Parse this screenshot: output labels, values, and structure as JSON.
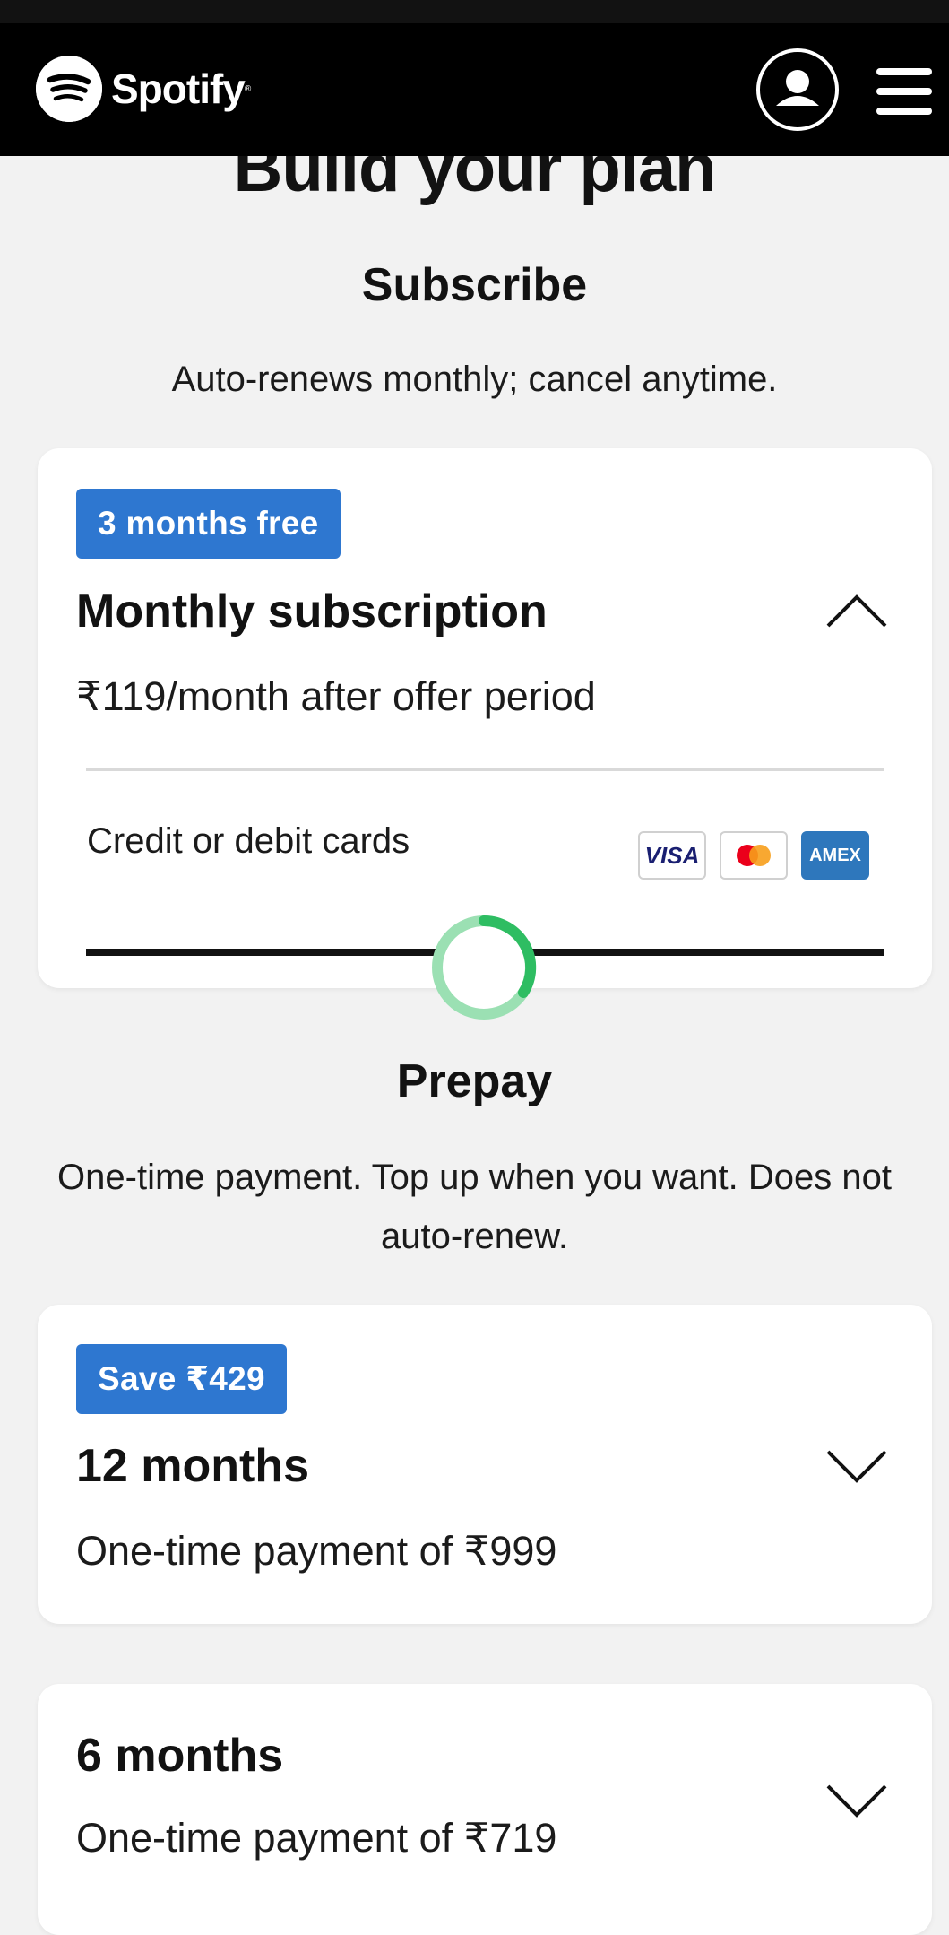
{
  "brand": {
    "name": "Spotify",
    "reg_mark": "®",
    "logo_icon": "spotify-logo-icon"
  },
  "header": {
    "account_icon": "user-account-icon",
    "menu_icon": "hamburger-menu-icon"
  },
  "page": {
    "title": "Build your plan"
  },
  "subscribe": {
    "heading": "Subscribe",
    "subtitle": "Auto-renews monthly; cancel anytime.",
    "plan": {
      "badge": "3 months free",
      "title": "Monthly subscription",
      "price": "₹119/month after offer period",
      "expanded": true,
      "payment_method_label": "Credit or debit cards",
      "card_logos": [
        "VISA",
        "mastercard",
        "AMEX"
      ]
    }
  },
  "prepay": {
    "heading": "Prepay",
    "subtitle": "One-time payment. Top up when you want. Does not auto-renew.",
    "plans": [
      {
        "badge": "Save ₹429",
        "title": "12 months",
        "price": "One-time payment of ₹999",
        "expanded": false
      },
      {
        "badge": "",
        "title": "6 months",
        "price": "One-time payment of ₹719",
        "expanded": false
      }
    ]
  },
  "colors": {
    "badge_blue": "#2e77d0",
    "spinner_green": "#1ed760",
    "header_bg": "#000000",
    "page_bg": "#f2f2f2"
  }
}
